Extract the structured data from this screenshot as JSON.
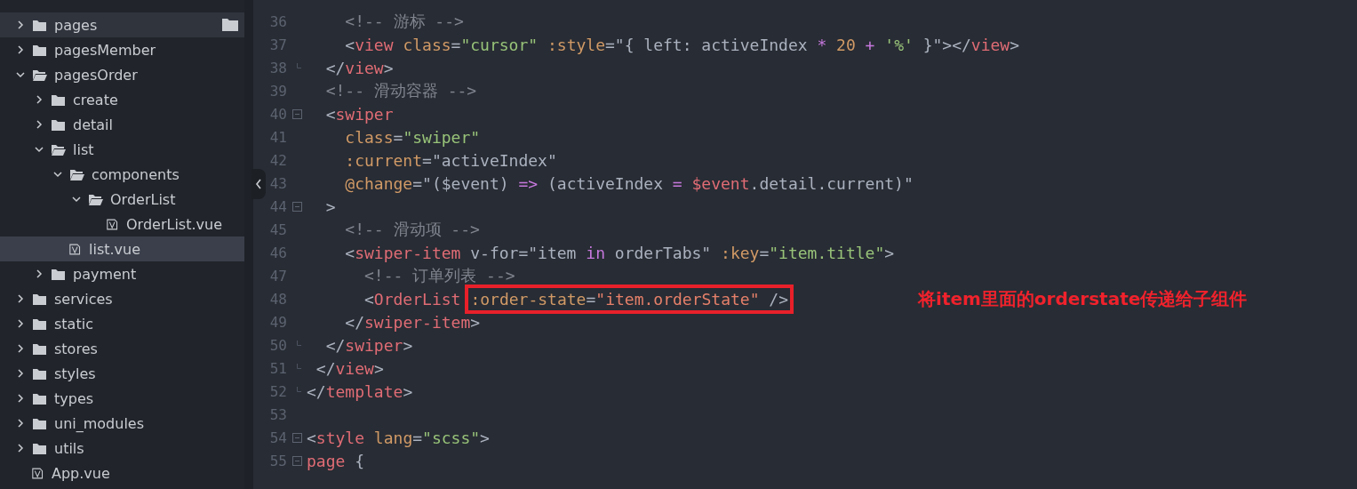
{
  "sidebar": {
    "items": [
      {
        "name": "pages",
        "kind": "folder",
        "expanded": false,
        "selected": false,
        "hovered": true
      },
      {
        "name": "pagesMember",
        "kind": "folder",
        "expanded": false,
        "selected": false,
        "hovered": false
      },
      {
        "name": "pagesOrder",
        "kind": "folder",
        "expanded": true,
        "selected": false,
        "hovered": false,
        "children": [
          {
            "name": "create",
            "kind": "folder",
            "expanded": false,
            "selected": false,
            "hovered": false
          },
          {
            "name": "detail",
            "kind": "folder",
            "expanded": false,
            "selected": false,
            "hovered": false
          },
          {
            "name": "list",
            "kind": "folder",
            "expanded": true,
            "selected": false,
            "hovered": false,
            "children": [
              {
                "name": "components",
                "kind": "folder",
                "expanded": true,
                "selected": false,
                "hovered": false,
                "children": [
                  {
                    "name": "OrderList",
                    "kind": "folder",
                    "expanded": true,
                    "selected": false,
                    "hovered": false,
                    "children": [
                      {
                        "name": "OrderList.vue",
                        "kind": "file",
                        "selected": false,
                        "hovered": false
                      }
                    ]
                  }
                ]
              },
              {
                "name": "list.vue",
                "kind": "file",
                "selected": true,
                "hovered": false
              }
            ]
          },
          {
            "name": "payment",
            "kind": "folder",
            "expanded": false,
            "selected": false,
            "hovered": false
          }
        ]
      },
      {
        "name": "services",
        "kind": "folder",
        "expanded": false,
        "selected": false,
        "hovered": false
      },
      {
        "name": "static",
        "kind": "folder",
        "expanded": false,
        "selected": false,
        "hovered": false
      },
      {
        "name": "stores",
        "kind": "folder",
        "expanded": false,
        "selected": false,
        "hovered": false
      },
      {
        "name": "styles",
        "kind": "folder",
        "expanded": false,
        "selected": false,
        "hovered": false
      },
      {
        "name": "types",
        "kind": "folder",
        "expanded": false,
        "selected": false,
        "hovered": false
      },
      {
        "name": "uni_modules",
        "kind": "folder",
        "expanded": false,
        "selected": false,
        "hovered": false
      },
      {
        "name": "utils",
        "kind": "folder",
        "expanded": false,
        "selected": false,
        "hovered": false
      },
      {
        "name": "App.vue",
        "kind": "file",
        "selected": false,
        "hovered": false
      }
    ]
  },
  "editor": {
    "lines": [
      {
        "number": "36",
        "fold_start": false,
        "fold_end": false,
        "tokens": [
          {
            "t": "    <!-- 游标 -->",
            "kind": "comment"
          }
        ]
      },
      {
        "number": "37",
        "fold_start": false,
        "fold_end": false,
        "tokens": [
          {
            "t": "    <",
            "kind": "punct"
          },
          {
            "t": "view",
            "kind": "tag"
          },
          {
            "t": " class",
            "kind": "attr"
          },
          {
            "t": "=",
            "kind": "punct"
          },
          {
            "t": "\"cursor\"",
            "kind": "string"
          },
          {
            "t": " :style",
            "kind": "attr"
          },
          {
            "t": "=\"{ left: activeIndex ",
            "kind": "punct"
          },
          {
            "t": "*",
            "kind": "keyword"
          },
          {
            "t": " 20 ",
            "kind": "number"
          },
          {
            "t": "+",
            "kind": "keyword"
          },
          {
            "t": " '%'",
            "kind": "string"
          },
          {
            "t": " }\"></",
            "kind": "punct"
          },
          {
            "t": "view",
            "kind": "tag"
          },
          {
            "t": ">",
            "kind": "punct"
          }
        ]
      },
      {
        "number": "38",
        "fold_start": false,
        "fold_end": true,
        "tokens": [
          {
            "t": "  </",
            "kind": "punct"
          },
          {
            "t": "view",
            "kind": "tag"
          },
          {
            "t": ">",
            "kind": "punct"
          }
        ]
      },
      {
        "number": "39",
        "fold_start": false,
        "fold_end": false,
        "tokens": [
          {
            "t": "  <!-- 滑动容器 -->",
            "kind": "comment"
          }
        ]
      },
      {
        "number": "40",
        "fold_start": true,
        "fold_end": false,
        "tokens": [
          {
            "t": "  <",
            "kind": "punct"
          },
          {
            "t": "swiper",
            "kind": "tag"
          }
        ]
      },
      {
        "number": "41",
        "fold_start": false,
        "fold_end": false,
        "tokens": [
          {
            "t": "    class",
            "kind": "attr"
          },
          {
            "t": "=",
            "kind": "punct"
          },
          {
            "t": "\"swiper\"",
            "kind": "string"
          }
        ]
      },
      {
        "number": "42",
        "fold_start": false,
        "fold_end": false,
        "tokens": [
          {
            "t": "    :current",
            "kind": "attr"
          },
          {
            "t": "=\"activeIndex\"",
            "kind": "punct"
          }
        ]
      },
      {
        "number": "43",
        "fold_start": false,
        "fold_end": false,
        "tokens": [
          {
            "t": "    @change",
            "kind": "attr"
          },
          {
            "t": "=\"($event) ",
            "kind": "punct"
          },
          {
            "t": "=>",
            "kind": "keyword"
          },
          {
            "t": " (activeIndex ",
            "kind": "punct"
          },
          {
            "t": "=",
            "kind": "keyword"
          },
          {
            "t": " $event",
            "kind": "variable"
          },
          {
            "t": ".detail.current)\"",
            "kind": "punct"
          }
        ]
      },
      {
        "number": "44",
        "fold_start": true,
        "fold_end": false,
        "tokens": [
          {
            "t": "  >",
            "kind": "punct"
          }
        ]
      },
      {
        "number": "45",
        "fold_start": false,
        "fold_end": false,
        "tokens": [
          {
            "t": "    <!-- 滑动项 -->",
            "kind": "comment"
          }
        ]
      },
      {
        "number": "46",
        "fold_start": false,
        "fold_end": false,
        "tokens": [
          {
            "t": "    <",
            "kind": "punct"
          },
          {
            "t": "swiper-item",
            "kind": "tag"
          },
          {
            "t": " v-for=\"item ",
            "kind": "punct"
          },
          {
            "t": "in",
            "kind": "keyword"
          },
          {
            "t": " orderTabs\"",
            "kind": "punct"
          },
          {
            "t": " :key",
            "kind": "attr"
          },
          {
            "t": "=",
            "kind": "punct"
          },
          {
            "t": "\"item.title\"",
            "kind": "string"
          },
          {
            "t": ">",
            "kind": "punct"
          }
        ]
      },
      {
        "number": "47",
        "fold_start": false,
        "fold_end": false,
        "tokens": [
          {
            "t": "      <!-- 订单列表 -->",
            "kind": "comment"
          }
        ]
      },
      {
        "number": "48",
        "fold_start": false,
        "fold_end": false,
        "tokens": [
          {
            "t": "      <",
            "kind": "punct"
          },
          {
            "t": "OrderList",
            "kind": "tag"
          }
        ],
        "boxed_tokens": [
          {
            "t": ":order-state",
            "kind": "attr"
          },
          {
            "t": "=",
            "kind": "punct"
          },
          {
            "t": "\"item.orderState\"",
            "kind": "expr"
          },
          {
            "t": " />",
            "kind": "punct"
          }
        ],
        "note": "将item里面的orderstate传递给子组件"
      },
      {
        "number": "49",
        "fold_start": false,
        "fold_end": false,
        "tokens": [
          {
            "t": "    </",
            "kind": "punct"
          },
          {
            "t": "swiper-item",
            "kind": "tag"
          },
          {
            "t": ">",
            "kind": "punct"
          }
        ]
      },
      {
        "number": "50",
        "fold_start": false,
        "fold_end": true,
        "tokens": [
          {
            "t": "  </",
            "kind": "punct"
          },
          {
            "t": "swiper",
            "kind": "tag"
          },
          {
            "t": ">",
            "kind": "punct"
          }
        ]
      },
      {
        "number": "51",
        "fold_start": false,
        "fold_end": true,
        "tokens": [
          {
            "t": " </",
            "kind": "punct"
          },
          {
            "t": "view",
            "kind": "tag"
          },
          {
            "t": ">",
            "kind": "punct"
          }
        ]
      },
      {
        "number": "52",
        "fold_start": false,
        "fold_end": true,
        "tokens": [
          {
            "t": "</",
            "kind": "punct"
          },
          {
            "t": "template",
            "kind": "tag"
          },
          {
            "t": ">",
            "kind": "punct"
          }
        ]
      },
      {
        "number": "53",
        "fold_start": false,
        "fold_end": false
      },
      {
        "number": "54",
        "fold_start": true,
        "fold_end": false,
        "tokens": [
          {
            "t": "<",
            "kind": "punct"
          },
          {
            "t": "style",
            "kind": "tag"
          },
          {
            "t": " lang",
            "kind": "attr"
          },
          {
            "t": "=",
            "kind": "punct"
          },
          {
            "t": "\"scss\"",
            "kind": "string"
          },
          {
            "t": ">",
            "kind": "punct"
          }
        ]
      },
      {
        "number": "55",
        "fold_start": true,
        "fold_end": false,
        "tokens": [
          {
            "t": "page",
            "kind": "tag"
          },
          {
            "t": " {",
            "kind": "punct"
          }
        ]
      }
    ]
  }
}
